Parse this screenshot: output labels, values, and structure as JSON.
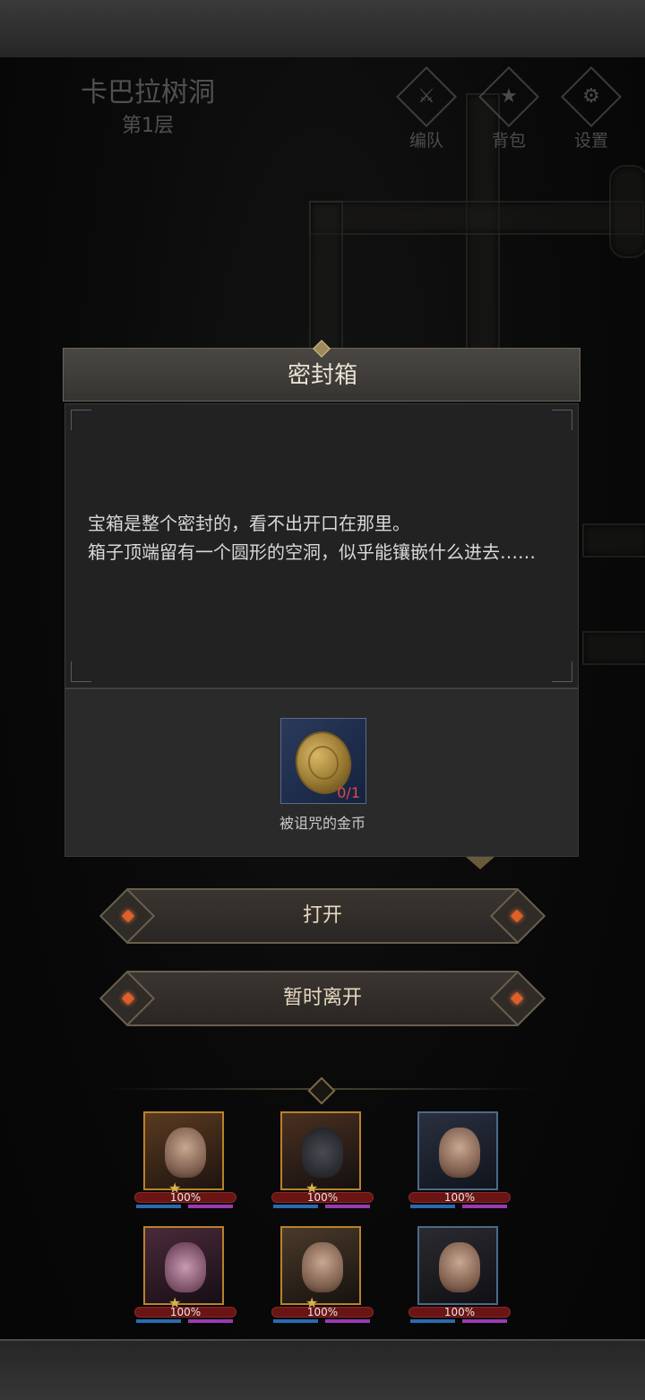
{
  "location": {
    "name": "卡巴拉树洞",
    "floor": "第1层"
  },
  "top_menu": [
    {
      "label": "编队",
      "icon": "formation-icon"
    },
    {
      "label": "背包",
      "icon": "backpack-icon"
    },
    {
      "label": "设置",
      "icon": "settings-gear-icon"
    }
  ],
  "dialog": {
    "title": "密封箱",
    "lines": [
      "宝箱是整个密封的，看不出开口在那里。",
      "箱子顶端留有一个圆形的空洞，似乎能镶嵌什么进去……"
    ],
    "required_item": {
      "name": "被诅咒的金币",
      "count": "0/1",
      "icon": "gold-coin-icon"
    }
  },
  "buttons": {
    "open": "打开",
    "leave": "暂时离开"
  },
  "party": [
    {
      "hp": "100%",
      "hp_fraction": 1.0
    },
    {
      "hp": "100%",
      "hp_fraction": 1.0
    },
    {
      "hp": "100%",
      "hp_fraction": 1.0
    },
    {
      "hp": "100%",
      "hp_fraction": 1.0
    },
    {
      "hp": "100%",
      "hp_fraction": 1.0
    },
    {
      "hp": "100%",
      "hp_fraction": 1.0
    }
  ]
}
